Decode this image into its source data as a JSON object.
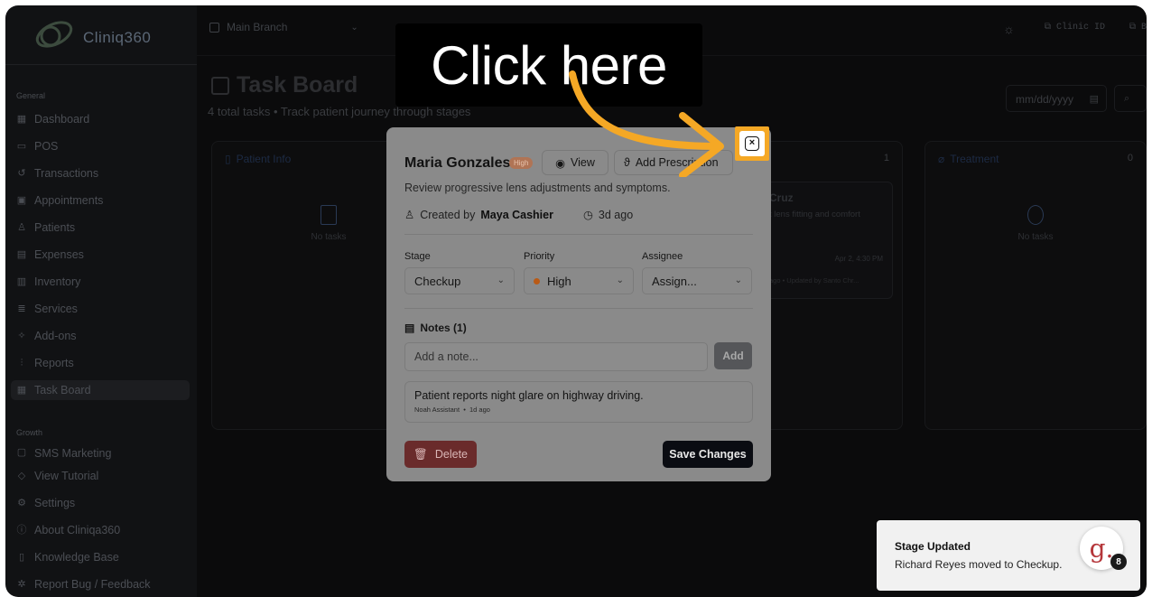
{
  "brand": {
    "logo_text": "Cliniq360"
  },
  "sidebar": {
    "section_general": "General",
    "section_growth": "Growth",
    "items": [
      {
        "label": "Dashboard",
        "icon": "grid-icon"
      },
      {
        "label": "POS",
        "icon": "register-icon"
      },
      {
        "label": "Transactions",
        "icon": "history-icon"
      },
      {
        "label": "Appointments",
        "icon": "calendar-icon"
      },
      {
        "label": "Patients",
        "icon": "users-icon"
      },
      {
        "label": "Expenses",
        "icon": "receipt-icon"
      },
      {
        "label": "Inventory",
        "icon": "boxes-icon"
      },
      {
        "label": "Services",
        "icon": "layers-icon"
      },
      {
        "label": "Add-ons",
        "icon": "puzzle-icon"
      },
      {
        "label": "Reports",
        "icon": "bar-chart-icon"
      },
      {
        "label": "Task Board",
        "icon": "kanban-icon"
      }
    ],
    "growth_items": [
      {
        "label": "SMS Marketing",
        "icon": "message-icon"
      },
      {
        "label": "View Tutorial",
        "icon": "graduation-icon"
      },
      {
        "label": "Settings",
        "icon": "gear-icon"
      },
      {
        "label": "About Cliniqa360",
        "icon": "info-icon"
      },
      {
        "label": "Knowledge Base",
        "icon": "book-icon"
      },
      {
        "label": "Report Bug / Feedback",
        "icon": "bug-icon"
      }
    ]
  },
  "topbar": {
    "branch": "Main Branch",
    "clinic_id_label": "Clinic ID",
    "clinic_id_tail": "B"
  },
  "page": {
    "title": "Task Board",
    "subtitle": "4 total tasks • Track patient journey through stages",
    "date_placeholder": "mm/dd/yyyy"
  },
  "columns": [
    {
      "name": "Patient Info",
      "count": "",
      "empty": "No tasks"
    },
    {
      "name": "",
      "count": "1",
      "empty": ""
    },
    {
      "name": "Treatment",
      "count": "0",
      "empty": "No tasks"
    }
  ],
  "bg_card": {
    "name": "Cruz",
    "desc": "t lens fitting and comfort",
    "date": "Apr 2, 4:30 PM",
    "footer": "ago • Updated by Santo Chr..."
  },
  "modal": {
    "patient": "Maria Gonzales",
    "priority_badge": "High",
    "view_label": "View",
    "prescription_label": "Add Prescription",
    "description": "Review progressive lens adjustments and symptoms.",
    "created_prefix": "Created by",
    "created_by": "Maya Cashier",
    "created_ago": "3d ago",
    "stage_label": "Stage",
    "stage_value": "Checkup",
    "priority_label": "Priority",
    "priority_value": "High",
    "assignee_label": "Assignee",
    "assignee_value": "Assign...",
    "notes_heading": "Notes (1)",
    "note_placeholder": "Add a note...",
    "add_label": "Add",
    "note_text": "Patient reports night glare on highway driving.",
    "note_author": "Noah Assistant",
    "note_time": "1d ago",
    "delete_label": "Delete",
    "save_label": "Save Changes"
  },
  "callout": {
    "text": "Click here"
  },
  "toast": {
    "title": "Stage Updated",
    "message": "Richard Reyes moved to Checkup."
  },
  "badge": {
    "letter": "g.",
    "count": "8"
  },
  "colors": {
    "highlight": "#f5a825",
    "delete": "#6a2b2b",
    "priority": "#b95a16"
  }
}
